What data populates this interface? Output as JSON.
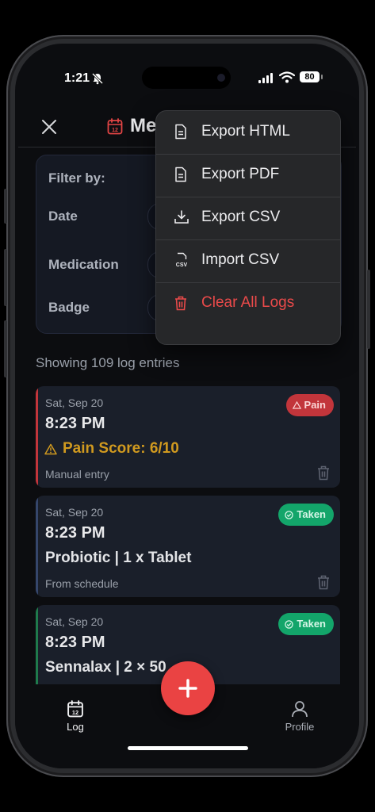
{
  "status_bar": {
    "time": "1:21",
    "battery": "80"
  },
  "header": {
    "title": "Me"
  },
  "filter": {
    "title": "Filter by:",
    "date_label": "Date",
    "medication_label": "Medication",
    "badge_label": "Badge"
  },
  "summary": {
    "text": "Showing 109 log entries"
  },
  "entries": [
    {
      "date": "Sat, Sep 20",
      "time": "8:23 PM",
      "description": "Pain Score: 6/10",
      "source": "Manual entry",
      "badge": "Pain"
    },
    {
      "date": "Sat, Sep 20",
      "time": "8:23 PM",
      "description": "Probiotic | 1 x Tablet",
      "source": "From schedule",
      "badge": "Taken"
    },
    {
      "date": "Sat, Sep 20",
      "time": "8:23 PM",
      "description": "Sennalax | 2 × 50",
      "source": "",
      "badge": "Taken"
    }
  ],
  "menu": {
    "items": [
      {
        "label": "Export HTML",
        "icon": "file-text-icon"
      },
      {
        "label": "Export PDF",
        "icon": "file-text-icon"
      },
      {
        "label": "Export CSV",
        "icon": "download-tray-icon"
      },
      {
        "label": "Import CSV",
        "icon": "csv-file-icon"
      },
      {
        "label": "Clear All Logs",
        "icon": "trash-icon"
      }
    ]
  },
  "tabs": {
    "log": "Log",
    "profile": "Profile",
    "log_icon_day": "12",
    "calendar_day": "12",
    "csv_text": "CSV"
  },
  "colors": {
    "accent_red": "#ea4343",
    "pain_badge": "#c2353b",
    "taken_badge": "#13a56a",
    "pain_text": "#d19a1f"
  }
}
